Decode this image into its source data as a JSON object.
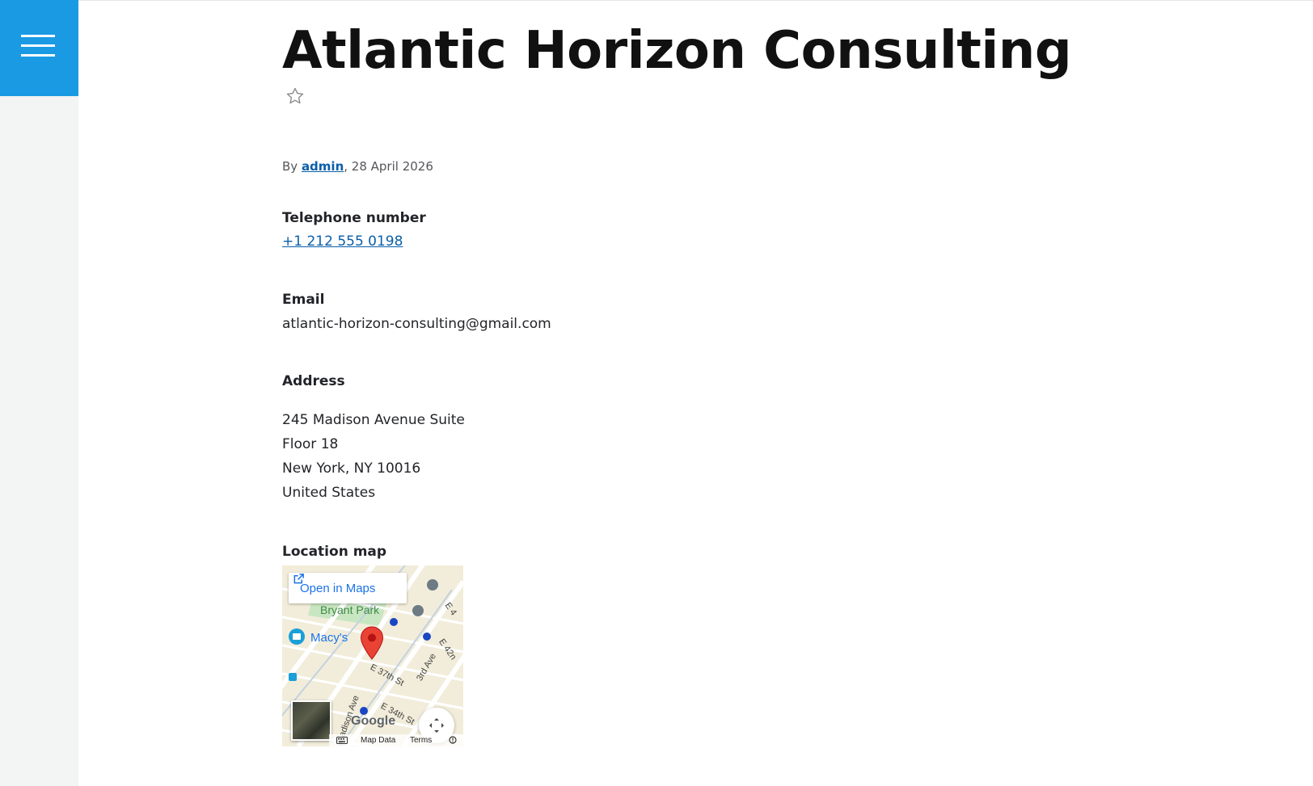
{
  "page": {
    "title": "Atlantic Horizon Consulting"
  },
  "meta": {
    "by": "By ",
    "author": "admin",
    "date": ", 28 April 2026"
  },
  "fields": {
    "phone_label": "Telephone number",
    "phone_value": "+1 212 555 0198",
    "email_label": "Email",
    "email_value": "atlantic-horizon-consulting@gmail.com",
    "address_label": "Address",
    "address_lines": [
      "245 Madison Avenue Suite",
      "Floor 18",
      "New York, NY 10016",
      "United States"
    ],
    "map_label": "Location map"
  },
  "map": {
    "open_in_maps": "Open in Maps",
    "places": [
      "Bryant Park",
      "Macy's"
    ],
    "streets": [
      "E 37th St",
      "3rd Ave",
      "E 34th St",
      "E 42n",
      "Madison Ave",
      "E 4"
    ],
    "google_logo": "Google",
    "footer": {
      "map_data": "Map Data",
      "terms": "Terms"
    }
  },
  "colors": {
    "menu_bg": "#1b9ae4",
    "link": "#0a5ea8",
    "map_link": "#1a73e8",
    "pin": "#ea4335"
  },
  "icons": {
    "menu": "hamburger-icon",
    "bookmark": "star-icon",
    "external": "external-link-icon",
    "pin": "map-pin-icon",
    "fullscreen": "fullscreen-icon",
    "keyboard": "keyboard-icon"
  }
}
